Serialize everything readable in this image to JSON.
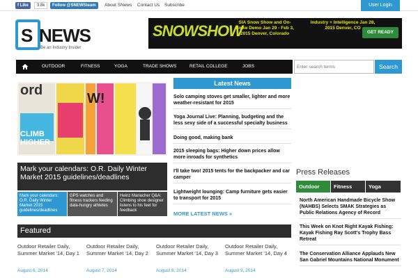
{
  "topbar": {
    "fb_like": "Like",
    "fb_count": "3.8k",
    "tw_follow": "Follow @SNEWSteam",
    "links": [
      "About SNews",
      "Contact Us",
      "Subscribe"
    ],
    "login": "User Login"
  },
  "logo": {
    "s": "S",
    "news": "NEWS",
    "tagline": "Be an Industry Insider"
  },
  "banner": {
    "brand": "SNOWSHOW",
    "line1": "SIA Snow Show and On-Snow Demo Jan 29 - Feb 3, 2015 Denver, Colorado",
    "line2": "Industry + Intelligence Jan 28, 2015 Denver, CO",
    "cta": "GET READY"
  },
  "nav": {
    "items": [
      "OUTDOOR",
      "FITNESS",
      "YOGA",
      "TRADE SHOWS",
      "RETAIL COLLEGE",
      "JOBS"
    ],
    "search_placeholder": "Enter search terms",
    "search_button": "Search"
  },
  "hero": {
    "image_text_1": "CLIMB",
    "image_text_2": "HIGHER",
    "caption": "Mark your calendars: O.R. Daily Winter Market 2015 guidelines/deadlines",
    "thumbs": [
      "Mark your calendars: O.R. Daily Winter Market 2015 guidelines/deadlines",
      "GPS watches and fitness trackers feeding data-hungry athletes",
      "Heinz Mariacher Q&A: Climbing shoe designer listens to his feet for feedback"
    ]
  },
  "latest": {
    "heading": "Latest News",
    "items": [
      "Solo camping stoves get smaller, lighter and more weather-resistant for 2015",
      "Yoga Journal Live: Planning, budgeting and the less sexy side of a successful specialty business",
      "Doing good, making bank",
      "2015 sleeping bags: Higher down prices allow more inroads for synthetics",
      "I'll take two! 2015 tents for the backpacker and car camper",
      "Lightweight lounging: Camp furniture gets easier to transport for 2015"
    ],
    "more": "MORE LATEST NEWS »"
  },
  "featured": {
    "heading": "Featured",
    "items": [
      {
        "title": "Outdoor Retailer Daily, Summer Market '14, Day 1",
        "date": "August 6, 2014"
      },
      {
        "title": "Outdoor Retailer Daily, Summer Market '14, Day 2",
        "date": "August 7, 2014"
      },
      {
        "title": "Outdoor Retailer Daily, Summer Market '14, Day 3",
        "date": "August 8, 2014"
      },
      {
        "title": "Outdoor Retailer Daily, Summer Market '14, Day 4",
        "date": "August 9, 2014"
      }
    ]
  },
  "press": {
    "heading": "Press Releases",
    "tabs": [
      "Outdoor",
      "Fitness",
      "Yoga"
    ],
    "items": [
      "North American Handmade Bicycle Show (NAHBS) Selects SMAK Strategies as Public Relations Agency of Record",
      "This Week on Knot Right Kayak Fishing: Kayak Fishing Ray Scott's Trophy Bass Retreat",
      "The Conservation Alliance Applauds New San Gabriel Mountains National Monument"
    ]
  },
  "colors": {
    "accent": "#2f98d1",
    "dark": "#111111",
    "tab_active": "#2e8b3a"
  }
}
